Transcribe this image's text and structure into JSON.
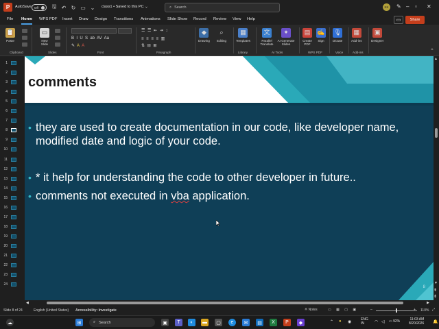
{
  "titlebar": {
    "autosave_label": "AutoSave",
    "autosave_state": "Off",
    "doc_title": "class1 • Saved to this PC ⌄",
    "search_placeholder": "Search",
    "avatar_initials": "KK"
  },
  "menu": {
    "tabs": [
      "File",
      "Home",
      "WPS PDF",
      "Insert",
      "Draw",
      "Design",
      "Transitions",
      "Animations",
      "Slide Show",
      "Record",
      "Review",
      "View",
      "Help"
    ],
    "active_tab": "Home",
    "share_label": "Share"
  },
  "ribbon": {
    "buttons": {
      "paste": "Paste",
      "new_slide": "New Slide",
      "drawing": "Drawing",
      "editing": "Editing",
      "templates": "Templates",
      "parallel_translate": "Parallel Translate",
      "ai_generate": "AI Generate Slides",
      "create_pdf": "Create PDF",
      "sign": "Sign",
      "dictate": "Dictate",
      "addins": "Add-ins",
      "designer": "Designer"
    },
    "groups": {
      "clipboard": "Clipboard",
      "slides": "Slides",
      "font": "Font",
      "paragraph": "Paragraph",
      "library": "Library",
      "ai_tools": "AI Tools",
      "wps_pdf": "WPS PDF",
      "voice": "Voice",
      "addins": "Add-ins"
    }
  },
  "thumbnails": {
    "numbers": [
      "1",
      "2",
      "3",
      "4",
      "5",
      "6",
      "7",
      "8",
      "9",
      "10",
      "11",
      "12",
      "13",
      "14",
      "15",
      "16",
      "17",
      "18",
      "19",
      "20",
      "21",
      "22",
      "23",
      "24"
    ],
    "selected": "8"
  },
  "slide": {
    "title": "comments",
    "bullets": [
      "they are used to create documentation in our code, like developer name, modified date and logic of your code.",
      "* it help for understanding the code to other developer in future..",
      "comments not executed in vba application."
    ],
    "bullet3_before": "comments not executed in ",
    "bullet3_misspelled": "vba",
    "bullet3_after": " application.",
    "page_number": "8",
    "colors": {
      "background": "#0f3f57",
      "header": "#ffffff",
      "accent": "#2aa9b8"
    }
  },
  "statusbar": {
    "slide_info": "Slide 8 of 24",
    "language": "English (United States)",
    "accessibility": "Accessibility: Investigate",
    "notes": "Notes",
    "zoom": "110%"
  },
  "taskbar": {
    "search_label": "Search",
    "lang": "ENG",
    "region": "IN",
    "battery": "92%",
    "time": "11:03 AM",
    "date": "8/20/2026"
  }
}
